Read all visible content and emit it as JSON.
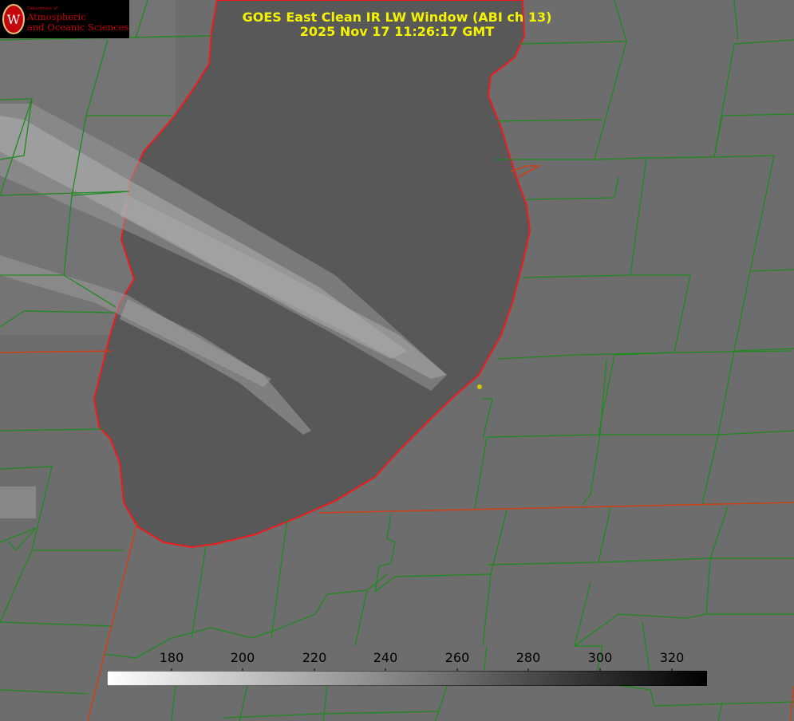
{
  "title": {
    "line1": "GOES East Clean IR LW Window (ABI ch 13)",
    "line2": "2025 Nov 17 11:26:17 GMT"
  },
  "logo": {
    "department": "Department of",
    "line1": "Atmospheric",
    "line2": "and Oceanic Sciences",
    "color": "#c5050c"
  },
  "colorbar": {
    "ticks": [
      "180",
      "200",
      "220",
      "240",
      "260",
      "280",
      "300",
      "320"
    ],
    "gradient_start": "#ffffff",
    "gradient_end": "#000000"
  },
  "colors": {
    "county_lines": "#1e8a1e",
    "state_lines": "#c8411a",
    "lake_outline": "#ee1c1c",
    "marker": "#d4c800",
    "title": "#f4f400"
  }
}
